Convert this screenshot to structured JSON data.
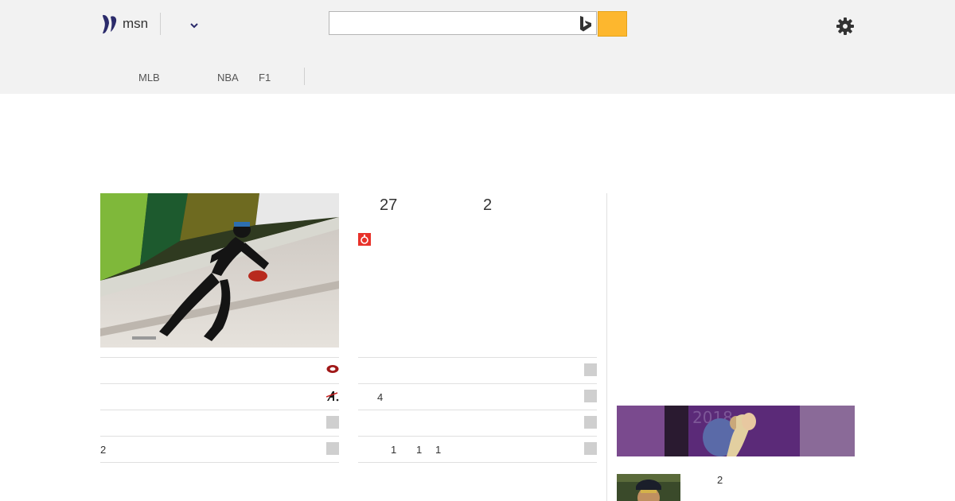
{
  "header": {
    "logo_text": "msn",
    "search": {
      "value": "",
      "placeholder": ""
    },
    "nav": [
      {
        "label": "MLB"
      },
      {
        "label": "NBA"
      },
      {
        "label": "F1"
      }
    ]
  },
  "main": {
    "scores": [
      "27",
      "2"
    ],
    "left_rows": [
      {
        "text": "",
        "icon": "red-oval-logo-icon"
      },
      {
        "text": "",
        "icon": "a-logo-icon"
      },
      {
        "text": "",
        "icon": "placeholder-icon"
      },
      {
        "text": "2",
        "icon": "placeholder-icon"
      }
    ],
    "right_rows": [
      {
        "texts": [],
        "icon": "placeholder-icon"
      },
      {
        "texts": [
          "4"
        ],
        "icon": "placeholder-icon"
      },
      {
        "texts": [],
        "icon": "placeholder-icon"
      },
      {
        "texts": [
          "1",
          "1",
          "1"
        ],
        "icon": "placeholder-icon"
      }
    ],
    "sidebar_item_text": "2"
  },
  "colors": {
    "header_bg": "#f2f2f2",
    "search_button": "#fdb72e",
    "logo": "#2b2b6b",
    "badge_red": "#e8322a"
  }
}
